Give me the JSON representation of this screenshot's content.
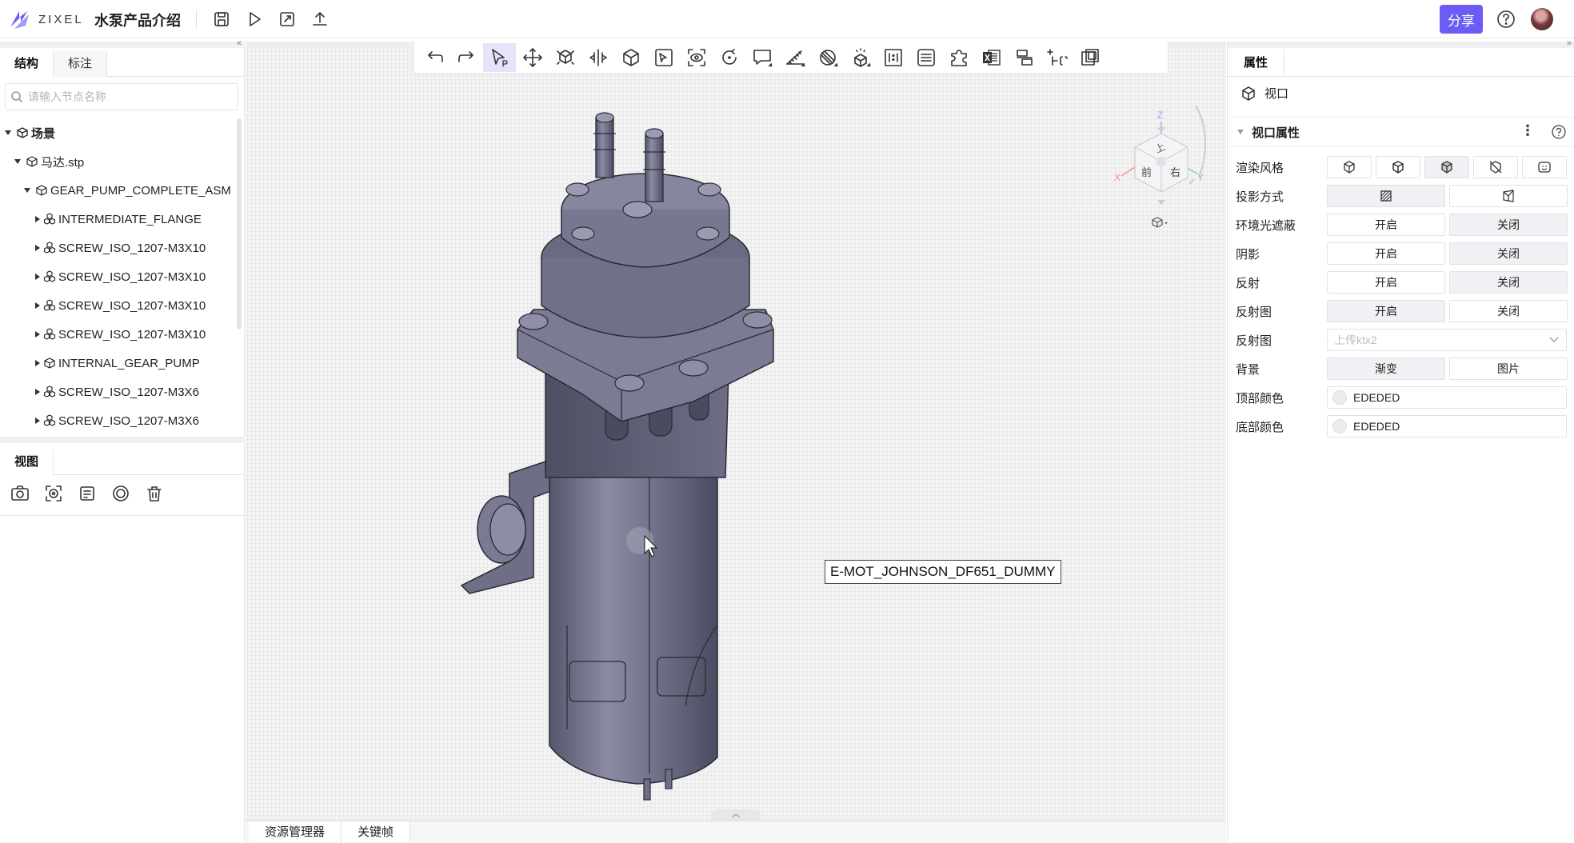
{
  "app": {
    "brand": "ZIXEL",
    "doc_title": "水泵产品介绍",
    "brand_color": "#6a5cf5"
  },
  "topbar": {
    "share_label": "分享"
  },
  "left_panel": {
    "tabs": [
      "结构",
      "标注"
    ],
    "search_placeholder": "请输入节点名称",
    "tree": [
      {
        "label": "场景",
        "depth": 0
      },
      {
        "label": "马达.stp",
        "depth": 1
      },
      {
        "label": "GEAR_PUMP_COMPLETE_ASM",
        "depth": 2
      },
      {
        "label": "INTERMEDIATE_FLANGE",
        "depth": 3
      },
      {
        "label": "SCREW_ISO_1207-M3X10",
        "depth": 3
      },
      {
        "label": "SCREW_ISO_1207-M3X10",
        "depth": 3
      },
      {
        "label": "SCREW_ISO_1207-M3X10",
        "depth": 3
      },
      {
        "label": "SCREW_ISO_1207-M3X10",
        "depth": 3
      },
      {
        "label": "INTERNAL_GEAR_PUMP",
        "depth": 3
      },
      {
        "label": "SCREW_ISO_1207-M3X6",
        "depth": 3
      },
      {
        "label": "SCREW_ISO_1207-M3X6",
        "depth": 3
      }
    ],
    "view_tab": "视图"
  },
  "viewport": {
    "tooltip": "E-MOT_JOHNSON_DF651_DUMMY",
    "viewcube": {
      "front": "前",
      "right": "右",
      "top": "上",
      "x": "X",
      "y": "Y",
      "z": "Z"
    },
    "bottom_tabs": [
      "资源管理器",
      "关键帧"
    ]
  },
  "right_panel": {
    "tab": "属性",
    "object_label": "视口",
    "section_title": "视口属性",
    "rows": {
      "render_style": "渲染风格",
      "projection": "投影方式",
      "ambient_occlusion": "环境光遮蔽",
      "shadow": "阴影",
      "reflection": "反射",
      "reflection_map": "反射图",
      "reflection_map_upload": "反射图",
      "background": "背景",
      "top_color": "顶部颜色",
      "bottom_color": "底部颜色"
    },
    "on": "开启",
    "off": "关闭",
    "upload_placeholder": "上传ktx2",
    "bg_gradient": "渐变",
    "bg_image": "图片",
    "top_color_value": "EDEDED",
    "bottom_color_value": "EDEDED"
  }
}
